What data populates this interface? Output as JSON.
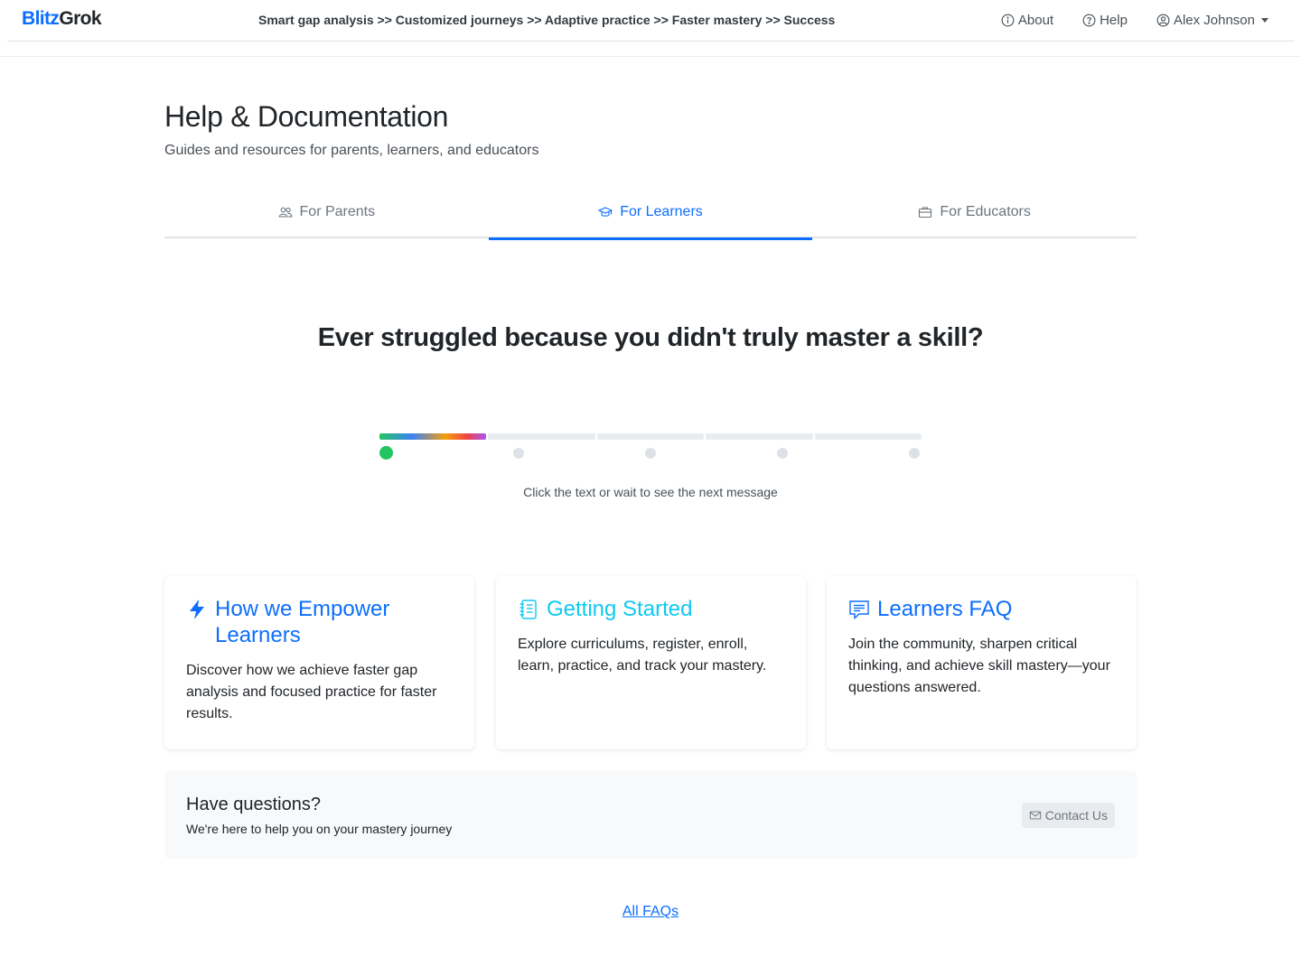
{
  "nav": {
    "brand_first": "Blitz",
    "brand_second": "Grok",
    "tagline": "Smart gap analysis >> Customized journeys >> Adaptive practice >> Faster mastery >> Success",
    "about": "About",
    "help": "Help",
    "user": "Alex Johnson"
  },
  "header": {
    "title": "Help & Documentation",
    "subtitle": "Guides and resources for parents, learners, and educators"
  },
  "tabs": [
    {
      "label": "For Parents",
      "icon": "people-icon",
      "active": false
    },
    {
      "label": "For Learners",
      "icon": "mortarboard-icon",
      "active": true
    },
    {
      "label": "For Educators",
      "icon": "briefcase-icon",
      "active": false
    }
  ],
  "hero": {
    "message": "Ever struggled because you didn't truly master a skill?",
    "hint": "Click the text or wait to see the next message",
    "total_messages": 5,
    "current_message": 1
  },
  "cards": [
    {
      "title": "How we Empower Learners",
      "body": "Discover how we achieve faster gap analysis and focused practice for faster results.",
      "icon": "lightning-icon"
    },
    {
      "title": "Getting Started",
      "body": "Explore curriculums, register, enroll, learn, practice, and track your mastery.",
      "icon": "journal-icon"
    },
    {
      "title": "Learners FAQ",
      "body": "Join the community, sharpen critical thinking, and achieve skill mastery—your questions answered.",
      "icon": "chat-icon"
    }
  ],
  "questions": {
    "title": "Have questions?",
    "subtitle": "We're here to help you on your mastery journey",
    "contact": "Contact Us"
  },
  "footer": {
    "all_faqs": "All FAQs"
  },
  "colors": {
    "primary": "#0d6efd",
    "cyan": "#0dcaf0",
    "progress_active": "#22c55e"
  }
}
